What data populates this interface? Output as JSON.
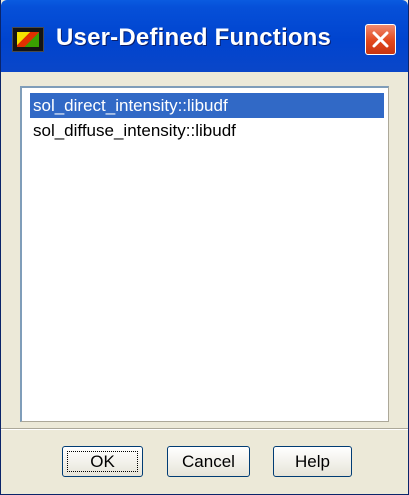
{
  "window": {
    "title": "User-Defined Functions",
    "icon": "fluent-app-icon",
    "close_icon": "close-icon"
  },
  "functions_list": {
    "items": [
      {
        "label": "sol_direct_intensity::libudf",
        "selected": true
      },
      {
        "label": "sol_diffuse_intensity::libudf",
        "selected": false
      }
    ]
  },
  "buttons": {
    "ok": "OK",
    "cancel": "Cancel",
    "help": "Help"
  },
  "colors": {
    "title_bar": "#0044CF",
    "selection": "#3169C6",
    "close_button": "#E2481C",
    "dialog_background": "#ECE9D8"
  }
}
